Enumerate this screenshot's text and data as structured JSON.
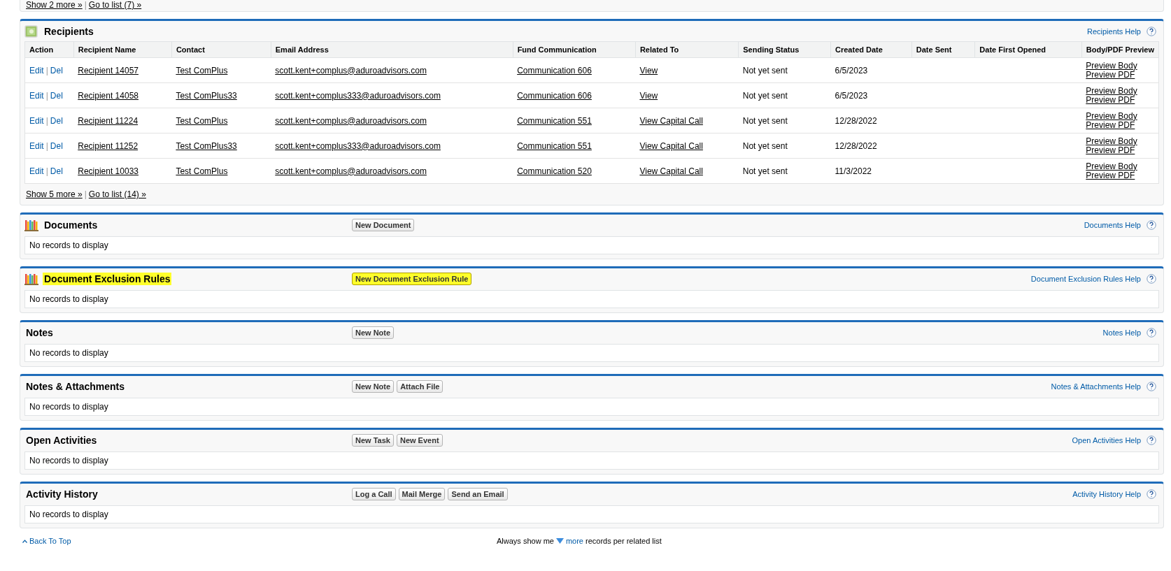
{
  "previous_list_links": {
    "show_more": "Show 2 more »",
    "separator": "|",
    "go_to_list": "Go to list (7) »"
  },
  "recipients": {
    "title": "Recipients",
    "help": "Recipients Help",
    "columns": [
      "Action",
      "Recipient Name",
      "Contact",
      "Email Address",
      "Fund Communication",
      "Related To",
      "Sending Status",
      "Created Date",
      "Date Sent",
      "Date First Opened",
      "Body/PDF Preview"
    ],
    "rows": [
      {
        "edit": "Edit",
        "separator": "|",
        "del": "Del",
        "name": "Recipient 14057",
        "contact": "Test ComPlus",
        "email": "scott.kent+complus@aduroadvisors.com",
        "communication": "Communication 606",
        "related": "View",
        "status": "Not yet sent",
        "created": "6/5/2023",
        "preview_body": "Preview Body",
        "preview_pdf": "Preview PDF"
      },
      {
        "edit": "Edit",
        "separator": "|",
        "del": "Del",
        "name": "Recipient 14058",
        "contact": "Test ComPlus33",
        "email": "scott.kent+complus333@aduroadvisors.com",
        "communication": "Communication 606",
        "related": "View",
        "status": "Not yet sent",
        "created": "6/5/2023",
        "preview_body": "Preview Body",
        "preview_pdf": "Preview PDF"
      },
      {
        "edit": "Edit",
        "separator": "|",
        "del": "Del",
        "name": "Recipient 11224",
        "contact": "Test ComPlus",
        "email": "scott.kent+complus@aduroadvisors.com",
        "communication": "Communication 551",
        "related": "View Capital Call",
        "status": "Not yet sent",
        "created": "12/28/2022",
        "preview_body": "Preview Body",
        "preview_pdf": "Preview PDF"
      },
      {
        "edit": "Edit",
        "separator": "|",
        "del": "Del",
        "name": "Recipient 11252",
        "contact": "Test ComPlus33",
        "email": "scott.kent+complus333@aduroadvisors.com",
        "communication": "Communication 551",
        "related": "View Capital Call",
        "status": "Not yet sent",
        "created": "12/28/2022",
        "preview_body": "Preview Body",
        "preview_pdf": "Preview PDF"
      },
      {
        "edit": "Edit",
        "separator": "|",
        "del": "Del",
        "name": "Recipient 10033",
        "contact": "Test ComPlus",
        "email": "scott.kent+complus@aduroadvisors.com",
        "communication": "Communication 520",
        "related": "View Capital Call",
        "status": "Not yet sent",
        "created": "11/3/2022",
        "preview_body": "Preview Body",
        "preview_pdf": "Preview PDF"
      }
    ],
    "show_more": "Show 5 more »",
    "separator": "|",
    "go_to_list": "Go to list (14) »"
  },
  "sections": [
    {
      "title": "Documents",
      "highlighted": false,
      "buttons": [
        {
          "label": "New Document",
          "highlighted": false
        }
      ],
      "help": "Documents Help",
      "empty": "No records to display"
    },
    {
      "title": "Document Exclusion Rules",
      "highlighted": true,
      "buttons": [
        {
          "label": "New Document Exclusion Rule",
          "highlighted": true
        }
      ],
      "help": "Document Exclusion Rules Help",
      "empty": "No records to display"
    },
    {
      "title": "Notes",
      "highlighted": false,
      "buttons": [
        {
          "label": "New Note",
          "highlighted": false
        }
      ],
      "help": "Notes Help",
      "empty": "No records to display"
    },
    {
      "title": "Notes & Attachments",
      "highlighted": false,
      "buttons": [
        {
          "label": "New Note",
          "highlighted": false
        },
        {
          "label": "Attach File",
          "highlighted": false
        }
      ],
      "help": "Notes & Attachments Help",
      "empty": "No records to display"
    },
    {
      "title": "Open Activities",
      "highlighted": false,
      "buttons": [
        {
          "label": "New Task",
          "highlighted": false
        },
        {
          "label": "New Event",
          "highlighted": false
        }
      ],
      "help": "Open Activities Help",
      "empty": "No records to display"
    },
    {
      "title": "Activity History",
      "highlighted": false,
      "buttons": [
        {
          "label": "Log a Call",
          "highlighted": false
        },
        {
          "label": "Mail Merge",
          "highlighted": false
        },
        {
          "label": "Send an Email",
          "highlighted": false
        }
      ],
      "help": "Activity History Help",
      "empty": "No records to display"
    }
  ],
  "footer": {
    "back_to_top": "Back To Top",
    "always_show": "Always show me",
    "more": "more",
    "per_list": "records per related list"
  }
}
